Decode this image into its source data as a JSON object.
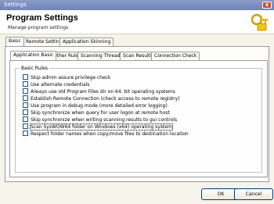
{
  "window": {
    "title": "Settings",
    "close_glyph": "x"
  },
  "header": {
    "title": "Program Settings",
    "subtitle": "Manage program settings",
    "icon": "key-lock-icon"
  },
  "outer_tabs": [
    "Basic",
    "Remote Settings",
    "Application Skinning"
  ],
  "inner_tabs": [
    "Application Basic",
    "Other Rules",
    "Scanning Threads",
    "Scan Results",
    "Connection Check"
  ],
  "group": {
    "title": "Basic Rules",
    "options": [
      {
        "label": "Skip admin assure privilege check",
        "checked": false
      },
      {
        "label": "Use alternate credentials",
        "checked": false
      },
      {
        "label": "Always use old Program Files dir on 64. bit operating systems",
        "checked": false
      },
      {
        "label": "Establish Remote Connection (check access to remote registry)",
        "checked": false
      },
      {
        "label": "Use program in debug mode (more detailed error logging)",
        "checked": false
      },
      {
        "label": "Skip synchronize when query for user logon at remote host",
        "checked": false
      },
      {
        "label": "Skip synchronize when writing scanning results to gui controls",
        "checked": false
      },
      {
        "label": "Scan SysWOW64 folder on Windows (x64) operating system",
        "checked": false,
        "focused": true
      },
      {
        "label": "Respect folder names when copy/move files to destination location",
        "checked": false
      }
    ]
  },
  "buttons": {
    "ok": "OK",
    "cancel": "Cancel"
  },
  "colors": {
    "titlebar": "#7f93c1",
    "checkbox_border": "#1c5180",
    "background": "#f6f3ea"
  }
}
